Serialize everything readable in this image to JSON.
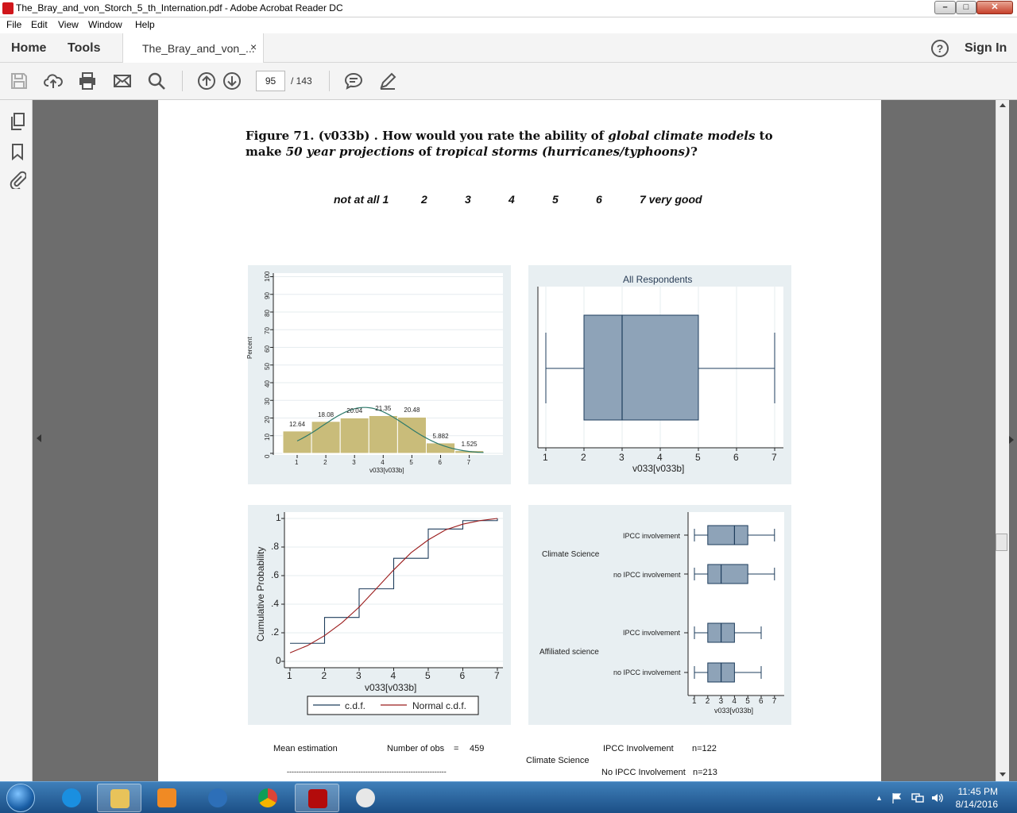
{
  "window": {
    "title": "The_Bray_and_von_Storch_5_th_Internation.pdf - Adobe Acrobat Reader DC",
    "min_icon": "minimize-icon",
    "max_icon": "maximize-icon",
    "close_icon": "close-icon"
  },
  "menu": {
    "items": [
      "File",
      "Edit",
      "View",
      "Window",
      "Help"
    ]
  },
  "tabs": {
    "home": "Home",
    "tools": "Tools",
    "document": "The_Bray_and_von_...",
    "close_glyph": "×",
    "help_glyph": "?",
    "sign_in": "Sign In"
  },
  "toolbar": {
    "icons": [
      "save-icon",
      "upload-icon",
      "print-icon",
      "email-icon",
      "search-icon",
      "page-up-icon",
      "page-down-icon",
      "comment-icon",
      "pen-icon"
    ],
    "page_current": "95",
    "page_total": "/ 143"
  },
  "sidebar": {
    "icons": [
      "pages-icon",
      "bookmark-icon",
      "attachment-icon"
    ]
  },
  "document": {
    "figure_title_parts": [
      "Figure 71. (v033b) . How would you rate the ability of ",
      "global climate models",
      " to make ",
      "50 year projections",
      " of ",
      "tropical storms (hurricanes/typhoons)",
      "?"
    ],
    "scale_labels": [
      "not at all 1",
      "2",
      "3",
      "4",
      "5",
      "6",
      "7 very good"
    ],
    "footer": {
      "mean_estimation": "Mean estimation",
      "number_of_obs": "Number of obs",
      "equals": "=",
      "obs_value": "459",
      "ipcc_involvement": "IPCC Involvement",
      "ipcc_n": "n=122",
      "climate_science": "Climate Science",
      "no_ipcc_involvement": "No IPCC Involvement",
      "no_ipcc_n": "n=213",
      "rule": "-------------------------------------------------------------------"
    }
  },
  "chart_data": [
    {
      "type": "bar",
      "categories": [
        "1",
        "2",
        "3",
        "4",
        "5",
        "6",
        "7"
      ],
      "values": [
        12.64,
        18.08,
        20.04,
        21.35,
        20.48,
        5.882,
        1.525
      ],
      "value_labels": [
        "12.64",
        "18.08",
        "20.04",
        "21.35",
        "20.48",
        "5.882",
        "1.525"
      ],
      "overlay_normal_curve": true,
      "xlabel": "v033[v033b]",
      "ylabel": "Percent",
      "ylim": [
        0,
        100
      ],
      "yticks": [
        "0",
        "10",
        "20",
        "30",
        "40",
        "50",
        "60",
        "70",
        "80",
        "90",
        "100"
      ],
      "grid": true
    },
    {
      "type": "box",
      "title": "All Respondents",
      "box": {
        "min": 1,
        "q1": 2,
        "median": 3,
        "q3": 5,
        "max": 7
      },
      "xlabel": "v033[v033b]",
      "xlim": [
        1,
        7
      ],
      "xticks": [
        "1",
        "2",
        "3",
        "4",
        "5",
        "6",
        "7"
      ],
      "grid": true
    },
    {
      "type": "line",
      "series": [
        {
          "name": "c.d.f.",
          "step": true,
          "x": [
            1,
            2,
            3,
            4,
            5,
            6,
            7
          ],
          "y": [
            0.1264,
            0.3072,
            0.5076,
            0.7211,
            0.9259,
            0.9847,
            1.0
          ]
        },
        {
          "name": "Normal c.d.f.",
          "x": [
            1,
            1.5,
            2,
            2.5,
            3,
            3.5,
            4,
            4.5,
            5,
            5.5,
            6,
            6.5,
            7
          ],
          "y": [
            0.06,
            0.11,
            0.18,
            0.27,
            0.38,
            0.51,
            0.64,
            0.76,
            0.85,
            0.92,
            0.96,
            0.985,
            1.0
          ]
        }
      ],
      "xlabel": "v033[v033b]",
      "ylabel": "Cumulative Probability",
      "xlim": [
        1,
        7
      ],
      "ylim": [
        0,
        1
      ],
      "xticks": [
        "1",
        "2",
        "3",
        "4",
        "5",
        "6",
        "7"
      ],
      "yticks": [
        "0",
        ".2",
        ".4",
        ".6",
        ".8",
        "1"
      ],
      "legend_placement": "bottom",
      "grid": true
    },
    {
      "type": "box",
      "groups": [
        "Climate Science",
        "Affiliated science"
      ],
      "boxes": [
        {
          "group": "Climate Science",
          "label": "IPCC involvement",
          "min": 1,
          "q1": 2,
          "median": 4,
          "q3": 5,
          "max": 7
        },
        {
          "group": "Climate Science",
          "label": "no IPCC involvement",
          "min": 1,
          "q1": 2,
          "median": 3,
          "q3": 5,
          "max": 7
        },
        {
          "group": "Affiliated science",
          "label": "IPCC involvement",
          "min": 1,
          "q1": 2,
          "median": 3,
          "q3": 4,
          "max": 6
        },
        {
          "group": "Affiliated science",
          "label": "no IPCC involvement",
          "min": 1,
          "q1": 2,
          "median": 3,
          "q3": 4,
          "max": 6
        }
      ],
      "xlabel": "v033[v033b]",
      "xlim": [
        1,
        7
      ],
      "xticks": [
        "1",
        "2",
        "3",
        "4",
        "5",
        "6",
        "7"
      ]
    }
  ],
  "taskbar": {
    "apps": [
      "internet-explorer-icon",
      "file-explorer-icon",
      "media-player-icon",
      "network-globe-icon",
      "chrome-icon",
      "acrobat-icon",
      "paint-icon"
    ],
    "time": "11:45 PM",
    "date": "8/14/2016",
    "tray_glyph": "▲"
  },
  "colors": {
    "bar_fill": "#c9bc7a",
    "box_fill": "#8ea3b8",
    "box_stroke": "#1e3d5c",
    "curve": "#2e7a6b",
    "cdf_step": "#1e3d5c",
    "normal_cdf": "#9b1c1c",
    "panel_bg": "#e8eff2"
  }
}
